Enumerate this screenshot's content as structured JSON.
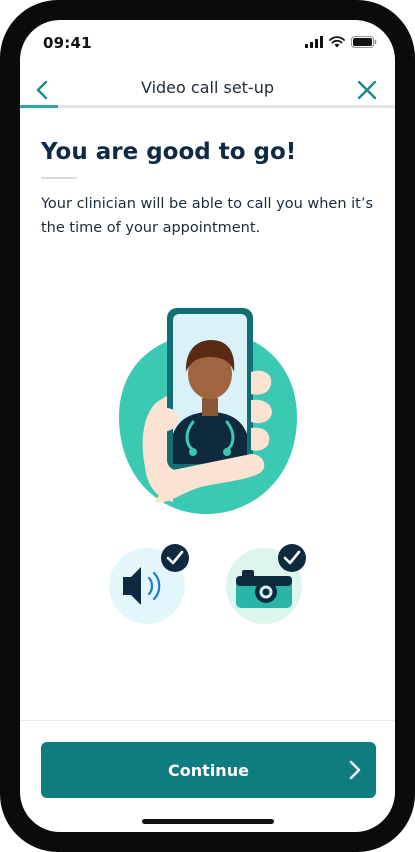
{
  "status_bar": {
    "time": "09:41",
    "icons": [
      "signal-icon",
      "wifi-icon",
      "battery-icon"
    ]
  },
  "header": {
    "title": "Video call set-up",
    "back_icon": "chevron-left-icon",
    "close_icon": "close-icon",
    "progress": 0.1
  },
  "content": {
    "heading": "You are good to go!",
    "body": "Your clinician will be able to call you when it’s the time of your appointment."
  },
  "illustration": {
    "name": "clinician-on-phone-illustration"
  },
  "permissions": [
    {
      "name": "speaker",
      "icon": "speaker-icon",
      "status_icon": "check-icon",
      "granted": true
    },
    {
      "name": "camera",
      "icon": "camera-icon",
      "status_icon": "check-icon",
      "granted": true
    }
  ],
  "footer": {
    "continue_label": "Continue",
    "continue_icon": "chevron-right-icon"
  },
  "colors": {
    "brand": "#0f7d80",
    "accent": "#2aa6a6",
    "blob": "#3cc9b4",
    "heading": "#0f2a47",
    "dark": "#0e2a3f"
  }
}
